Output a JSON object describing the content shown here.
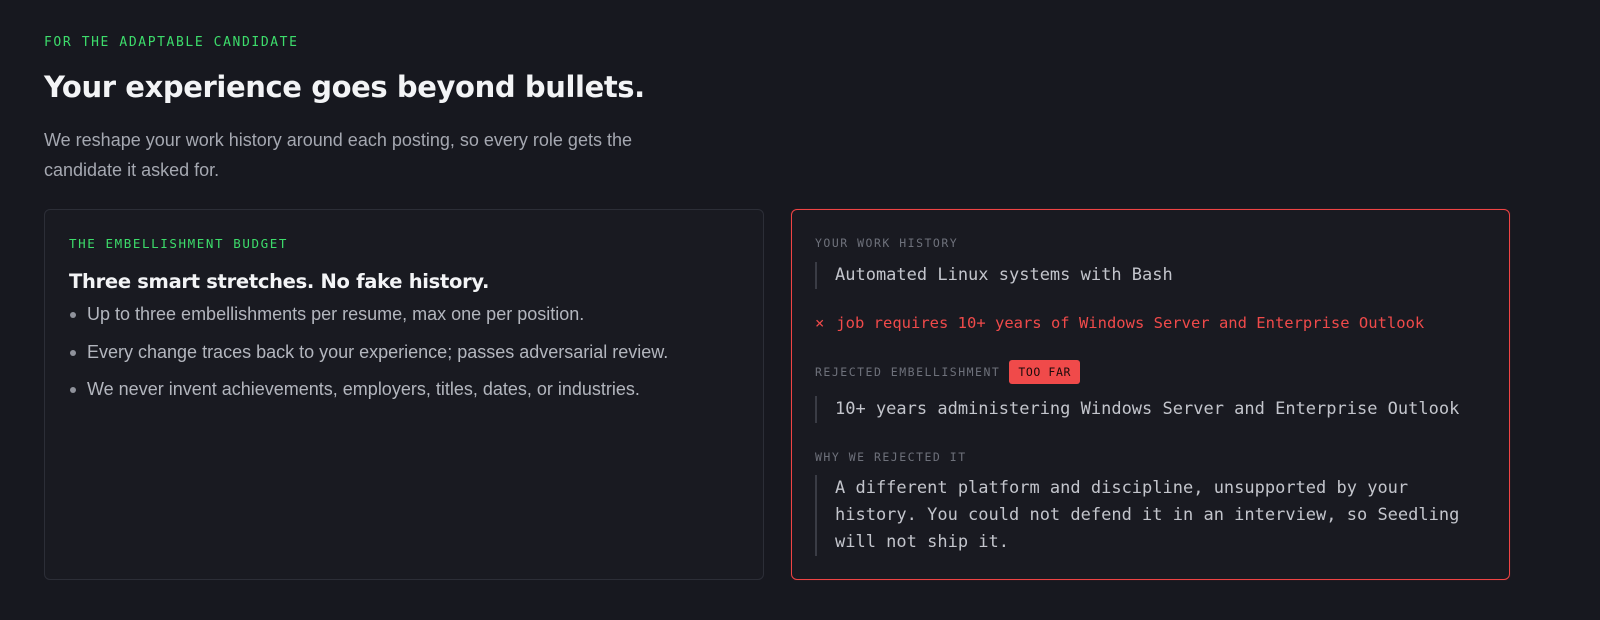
{
  "hero": {
    "eyebrow": "FOR THE ADAPTABLE CANDIDATE",
    "headline": "Your experience goes beyond bullets.",
    "lede": "We reshape your work history around each posting, so every role gets the candidate it asked for."
  },
  "budget_card": {
    "eyebrow": "THE EMBELLISHMENT BUDGET",
    "title": "Three smart stretches. No fake history.",
    "bullets": [
      "Up to three embellishments per resume, max one per position.",
      "Every change traces back to your experience; passes adversarial review.",
      "We never invent achievements, employers, titles, dates, or industries."
    ]
  },
  "example_card": {
    "history_label": "YOUR WORK HISTORY",
    "history_text": "Automated Linux systems with Bash",
    "conflict_icon": "×",
    "conflict_text": "job requires 10+ years of Windows Server and Enterprise Outlook",
    "rejected_label": "REJECTED EMBELLISHMENT",
    "badge": "TOO FAR",
    "rejected_text": "10+ years administering Windows Server and Enterprise Outlook",
    "why_label": "WHY WE REJECTED IT",
    "why_text": "A different platform and discipline, unsupported by your history. You could not defend it in an interview, so Seedling will not ship it."
  },
  "colors": {
    "background": "#17181f",
    "accent_green": "#3ddc6b",
    "danger_red": "#ef4444"
  }
}
